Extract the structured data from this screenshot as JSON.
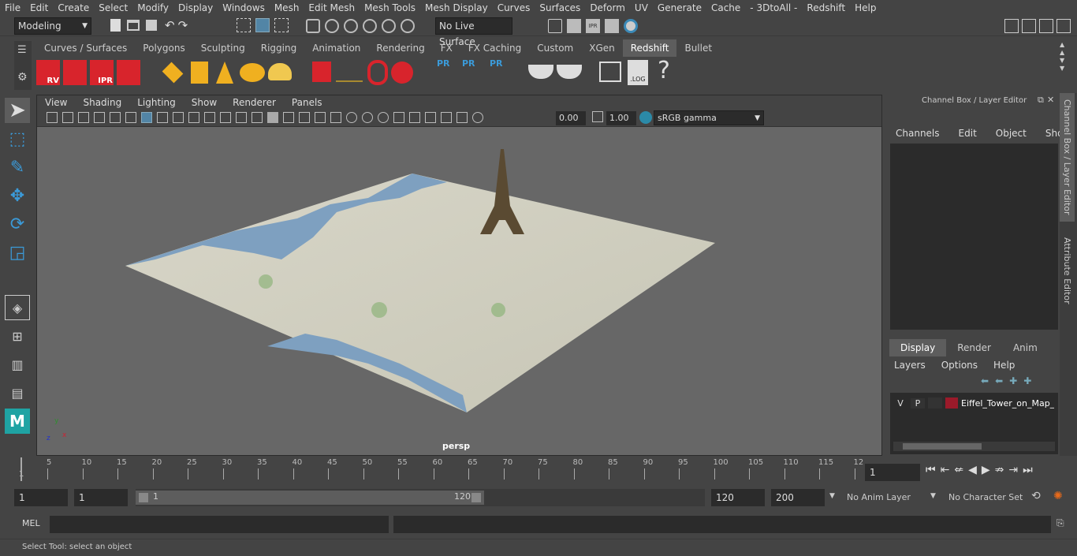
{
  "menubar": [
    "File",
    "Edit",
    "Create",
    "Select",
    "Modify",
    "Display",
    "Windows",
    "Mesh",
    "Edit Mesh",
    "Mesh Tools",
    "Mesh Display",
    "Curves",
    "Surfaces",
    "Deform",
    "UV",
    "Generate",
    "Cache",
    "- 3DtoAll -",
    "Redshift",
    "Help"
  ],
  "status": {
    "workspace": "Modeling",
    "live_surface": "No Live Surface"
  },
  "shelf": {
    "tabs": [
      "Curves / Surfaces",
      "Polygons",
      "Sculpting",
      "Rigging",
      "Animation",
      "Rendering",
      "FX",
      "FX Caching",
      "Custom",
      "XGen",
      "Redshift",
      "Bullet"
    ],
    "active_tab": "Redshift",
    "icon_labels": {
      "rv": "RV",
      "ipr": "IPR",
      "pr1": "PR",
      "pr2": "PR",
      "pr3": "PR",
      "log": ".LOG",
      "help": "?"
    }
  },
  "viewport": {
    "menus": [
      "View",
      "Shading",
      "Lighting",
      "Show",
      "Renderer",
      "Panels"
    ],
    "exposure": "0.00",
    "gamma": "1.00",
    "color_space": "sRGB gamma",
    "camera_label": "persp",
    "axis": {
      "x": "x",
      "y": "y",
      "z": "z"
    }
  },
  "channel_box": {
    "title": "Channel Box / Layer Editor",
    "menus": [
      "Channels",
      "Edit",
      "Object",
      "Show"
    ]
  },
  "layer_editor": {
    "tabs": [
      "Display",
      "Render",
      "Anim"
    ],
    "active_tab": "Display",
    "menus": [
      "Layers",
      "Options",
      "Help"
    ],
    "layers": [
      {
        "v": "V",
        "p": "P",
        "name": "Eiffel_Tower_on_Map_",
        "color": "#9b1a2a"
      }
    ]
  },
  "side_tabs": [
    "Channel Box / Layer Editor",
    "Attribute Editor"
  ],
  "timeline": {
    "ticks": [
      "5",
      "10",
      "15",
      "20",
      "25",
      "30",
      "35",
      "40",
      "45",
      "50",
      "55",
      "60",
      "65",
      "70",
      "75",
      "80",
      "85",
      "90",
      "95",
      "100",
      "105",
      "110",
      "115",
      "12"
    ],
    "start_label": "1",
    "current_frame": "1"
  },
  "range": {
    "start": "1",
    "playback_start": "1",
    "slider_start": "1",
    "slider_end": "120",
    "playback_end": "120",
    "end": "200",
    "anim_layer": "No Anim Layer",
    "character_set": "No Character Set"
  },
  "command": {
    "label": "MEL"
  },
  "help_line": "Select Tool: select an object",
  "colors": {
    "accent": "#5285a6",
    "redshift_red": "#d8242c",
    "layer_color": "#9b1a2a"
  }
}
